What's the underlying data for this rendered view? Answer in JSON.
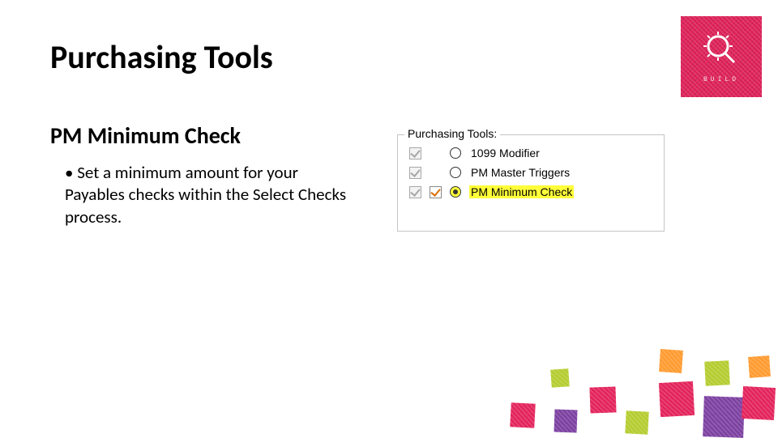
{
  "title": "Purchasing Tools",
  "subtitle": "PM Minimum Check",
  "bullet": "Set a minimum amount for your Payables checks within the Select Checks process.",
  "logo_word": "BUILD",
  "groupbox": {
    "legend": "Purchasing Tools:",
    "rows": [
      {
        "label": "1099 Modifier",
        "chk1": "disabled",
        "chk2": "none",
        "radio": "off",
        "hl": false
      },
      {
        "label": "PM Master Triggers",
        "chk1": "disabled",
        "chk2": "none",
        "radio": "off",
        "hl": false
      },
      {
        "label": "PM Minimum Check",
        "chk1": "disabled",
        "chk2": "active",
        "radio": "on",
        "hl": true
      }
    ]
  }
}
